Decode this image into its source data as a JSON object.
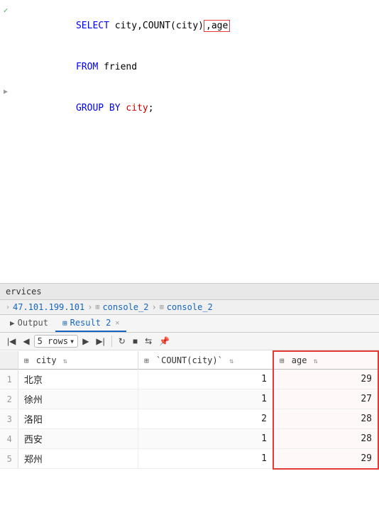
{
  "editor": {
    "lines": [
      {
        "indicator": "✓",
        "indicator_type": "check",
        "content_parts": [
          {
            "text": "SELECT ",
            "class": "kw-blue"
          },
          {
            "text": "city",
            "class": "col-default"
          },
          {
            "text": ",COUNT(city)",
            "class": "col-default"
          },
          {
            "text": ",age",
            "class": "highlight",
            "highlight": true
          }
        ]
      },
      {
        "indicator": "",
        "indicator_type": "none",
        "content_parts": [
          {
            "text": "FROM ",
            "class": "kw-blue"
          },
          {
            "text": "friend",
            "class": "col-default"
          }
        ]
      },
      {
        "indicator": "▶",
        "indicator_type": "arrow",
        "content_parts": [
          {
            "text": "GROUP BY ",
            "class": "kw-blue"
          },
          {
            "text": "city",
            "class": "kw-red"
          },
          {
            "text": ";",
            "class": "col-default"
          }
        ]
      }
    ]
  },
  "bottom": {
    "services_label": "ervices",
    "breadcrumb": {
      "ip": "47.101.199.101",
      "sep1": "›",
      "db1": "console_2",
      "sep2": "›",
      "db2": "console_2"
    },
    "tabs": [
      {
        "label": "Output",
        "icon": "▶",
        "active": false,
        "closable": false
      },
      {
        "label": "Result 2",
        "icon": "⊞",
        "active": true,
        "closable": true
      }
    ],
    "toolbar": {
      "first_btn": "|◀",
      "prev_btn": "◀",
      "rows_label": "5 rows",
      "rows_dropdown": "▾",
      "next_btn": "▶",
      "last_btn": "▶|",
      "refresh_btn": "↻",
      "stop_btn": "■",
      "export_btn": "⇆",
      "pin_btn": "📌"
    },
    "table": {
      "columns": [
        {
          "label": "",
          "type": "rownum"
        },
        {
          "label": "city",
          "icon": "⊞",
          "sort": "⇅"
        },
        {
          "label": "`COUNT(city)`",
          "icon": "⊞",
          "sort": "⇅"
        },
        {
          "label": "age",
          "icon": "⊞",
          "sort": "⇅",
          "highlighted": true
        }
      ],
      "rows": [
        {
          "num": 1,
          "city": "北京",
          "count": 1,
          "age": 29
        },
        {
          "num": 2,
          "city": "徐州",
          "count": 1,
          "age": 27
        },
        {
          "num": 3,
          "city": "洛阳",
          "count": 2,
          "age": 28
        },
        {
          "num": 4,
          "city": "西安",
          "count": 1,
          "age": 28
        },
        {
          "num": 5,
          "city": "郑州",
          "count": 1,
          "age": 29
        }
      ]
    }
  }
}
